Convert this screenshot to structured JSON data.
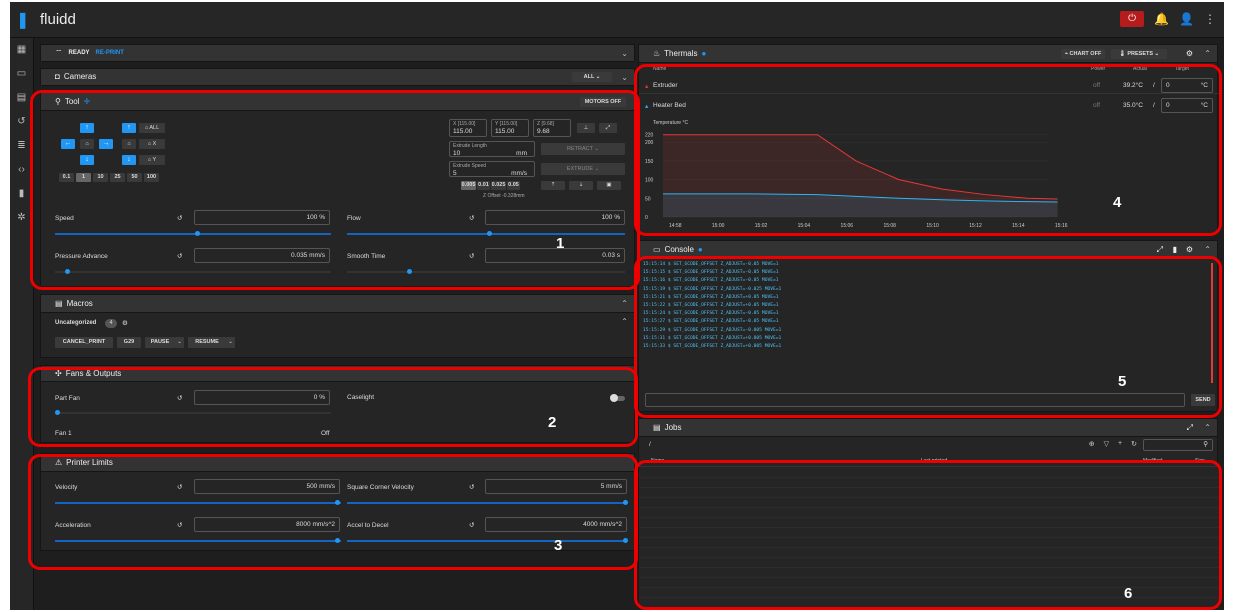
{
  "app": {
    "title": "fluidd",
    "brand_color": "#2196f3"
  },
  "status": {
    "ready": "READY",
    "reprint": "RE-PRINT"
  },
  "cameras": {
    "title": "Cameras",
    "all_label": "ALL"
  },
  "tool": {
    "title": "Tool",
    "motors_off": "MOTORS OFF",
    "buttons": {
      "all": "ALL",
      "x": "X",
      "y": "Y"
    },
    "steps": [
      "0.1",
      "1",
      "10",
      "25",
      "50",
      "100"
    ],
    "positions": [
      {
        "label": "X [115.00]",
        "value": "115.00"
      },
      {
        "label": "Y [115.00]",
        "value": "115.00"
      },
      {
        "label": "Z [9.68]",
        "value": "9.68"
      }
    ],
    "extrude_length_label": "Extrude Length",
    "extrude_length": "10",
    "extrude_length_unit": "mm",
    "extrude_speed_label": "Extrude Speed",
    "extrude_speed": "5",
    "extrude_speed_unit": "mm/s",
    "retract": "RETRACT",
    "extrude": "EXTRUDE",
    "zsteps": [
      "0.005",
      "0.01",
      "0.025",
      "0.05"
    ],
    "zoffset": "Z Offset -0.328mm",
    "speed_label": "Speed",
    "speed_value": "100 %",
    "flow_label": "Flow",
    "flow_value": "100 %",
    "pa_label": "Pressure Advance",
    "pa_value": "0.035 mm/s",
    "smooth_label": "Smooth Time",
    "smooth_value": "0.03 s"
  },
  "macros": {
    "title": "Macros",
    "group": "Uncategorized",
    "count": "4",
    "items": [
      "CANCEL_PRINT",
      "G29",
      "PAUSE",
      "RESUME"
    ]
  },
  "fans": {
    "title": "Fans & Outputs",
    "part_fan": "Part Fan",
    "part_fan_value": "0 %",
    "caselight": "Caselight",
    "fan1": "Fan 1",
    "fan1_value": "Off"
  },
  "limits": {
    "title": "Printer Limits",
    "velocity": "Velocity",
    "velocity_value": "500 mm/s",
    "scv": "Square Corner Velocity",
    "scv_value": "5 mm/s",
    "accel": "Acceleration",
    "accel_value": "8000 mm/s^2",
    "a2d": "Accel to Decel",
    "a2d_value": "4000 mm/s^2"
  },
  "thermals": {
    "title": "Thermals",
    "chart_off": "CHART OFF",
    "presets": "PRESETS",
    "headers": [
      "Name",
      "Power",
      "Actual",
      "Target"
    ],
    "rows": [
      {
        "name": "Extruder",
        "power": "off",
        "actual": "39.2°C",
        "target": "0",
        "unit": "°C"
      },
      {
        "name": "Heater Bed",
        "power": "off",
        "actual": "35.0°C",
        "target": "0",
        "unit": "°C"
      }
    ],
    "chart_label": "Temperature °C"
  },
  "chart_data": {
    "type": "line",
    "ylabel": "Temperature °C",
    "ylim": [
      0,
      230
    ],
    "yticks": [
      "0",
      "50",
      "100",
      "150",
      "200",
      "220"
    ],
    "xticks": [
      "14:58",
      "15:00",
      "15:02",
      "15:04",
      "15:06",
      "15:08",
      "15:10",
      "15:12",
      "15:14",
      "15:16"
    ],
    "series": [
      {
        "name": "Extruder",
        "color": "#e53935",
        "x": [
          0,
          2,
          3.6,
          4.5,
          5.5,
          6.5,
          7.5,
          8.5,
          9.2
        ],
        "values": [
          220,
          220,
          220,
          150,
          100,
          75,
          60,
          50,
          48
        ]
      },
      {
        "name": "Heater Bed",
        "color": "#29b6f6",
        "x": [
          0,
          2,
          3.6,
          4.5,
          5.5,
          6.5,
          7.5,
          8.5,
          9.2
        ],
        "values": [
          62,
          62,
          60,
          55,
          50,
          46,
          43,
          41,
          40
        ]
      }
    ]
  },
  "console": {
    "title": "Console",
    "send": "SEND",
    "lines": [
      "15:15:14  $ SET_GCODE_OFFSET Z_ADJUST=-0.05 MOVE=1",
      "15:15:15  $ SET_GCODE_OFFSET Z_ADJUST=-0.05 MOVE=1",
      "15:15:16  $ SET_GCODE_OFFSET Z_ADJUST=-0.05 MOVE=1",
      "15:15:19  $ SET_GCODE_OFFSET Z_ADJUST=-0.025 MOVE=1",
      "15:15:21  $ SET_GCODE_OFFSET Z_ADJUST=+0.05 MOVE=1",
      "15:15:22  $ SET_GCODE_OFFSET Z_ADJUST=+0.05 MOVE=1",
      "15:15:24  $ SET_GCODE_OFFSET Z_ADJUST=-0.05 MOVE=1",
      "15:15:27  $ SET_GCODE_OFFSET Z_ADJUST=-0.05 MOVE=1",
      "15:15:29  $ SET_GCODE_OFFSET Z_ADJUST=-0.005 MOVE=1",
      "15:15:31  $ SET_GCODE_OFFSET Z_ADJUST=+0.005 MOVE=1",
      "15:15:33  $ SET_GCODE_OFFSET Z_ADJUST=+0.005 MOVE=1"
    ]
  },
  "jobs": {
    "title": "Jobs",
    "path": "/",
    "headers": [
      "Name",
      "Last printed",
      "Modified",
      "Size"
    ]
  },
  "annotations": [
    "1",
    "2",
    "3",
    "4",
    "5",
    "6"
  ],
  "annotation_color": "#e00000"
}
